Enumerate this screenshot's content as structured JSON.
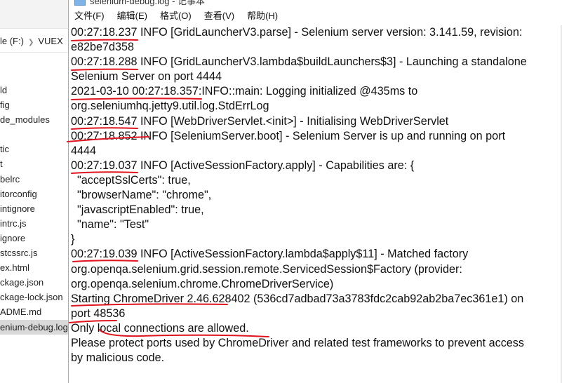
{
  "explorer": {
    "breadcrumb": [
      "le (F:)",
      "VUEX"
    ],
    "files": [
      "ld",
      "fig",
      "de_modules",
      "",
      "tic",
      "t",
      "belrc",
      "itorconfig",
      "intignore",
      "intrc.js",
      "ignore",
      "stcssrc.js",
      "ex.html",
      "ckage.json",
      "ckage-lock.json",
      "ADME.md",
      "enium-debug.log"
    ],
    "selected": "enium-debug.log"
  },
  "notepad": {
    "title": "selenium-debug.log - 记事本",
    "menu": [
      "文件(F)",
      "编辑(E)",
      "格式(O)",
      "查看(V)",
      "帮助(H)"
    ],
    "lines": [
      "00:27:18.237 INFO [GridLauncherV3.parse] - Selenium server version: 3.141.59, revision:",
      "e82be7d358",
      "00:27:18.288 INFO [GridLauncherV3.lambda$buildLaunchers$3] - Launching a standalone",
      "Selenium Server on port 4444",
      "2021-03-10 00:27:18.357:INFO::main: Logging initialized @435ms to",
      "org.seleniumhq.jetty9.util.log.StdErrLog",
      "00:27:18.547 INFO [WebDriverServlet.<init>] - Initialising WebDriverServlet",
      "00:27:18.852 INFO [SeleniumServer.boot] - Selenium Server is up and running on port",
      "4444",
      "00:27:19.037 INFO [ActiveSessionFactory.apply] - Capabilities are: {",
      "  \"acceptSslCerts\": true,",
      "  \"browserName\": \"chrome\",",
      "  \"javascriptEnabled\": true,",
      "  \"name\": \"Test\"",
      "}",
      "00:27:19.039 INFO [ActiveSessionFactory.lambda$apply$11] - Matched factory",
      "org.openqa.selenium.grid.session.remote.ServicedSession$Factory (provider:",
      "org.openqa.selenium.chrome.ChromeDriverService)",
      "Starting ChromeDriver 2.46.628402 (536cd7adbad73a3783fdc2cab92ab2ba7ec361e1) on",
      "port 48536",
      "Only local connections are allowed.",
      "Please protect ports used by ChromeDriver and related test frameworks to prevent access",
      "by malicious code."
    ]
  },
  "colors": {
    "annotation": "#e0141e"
  }
}
